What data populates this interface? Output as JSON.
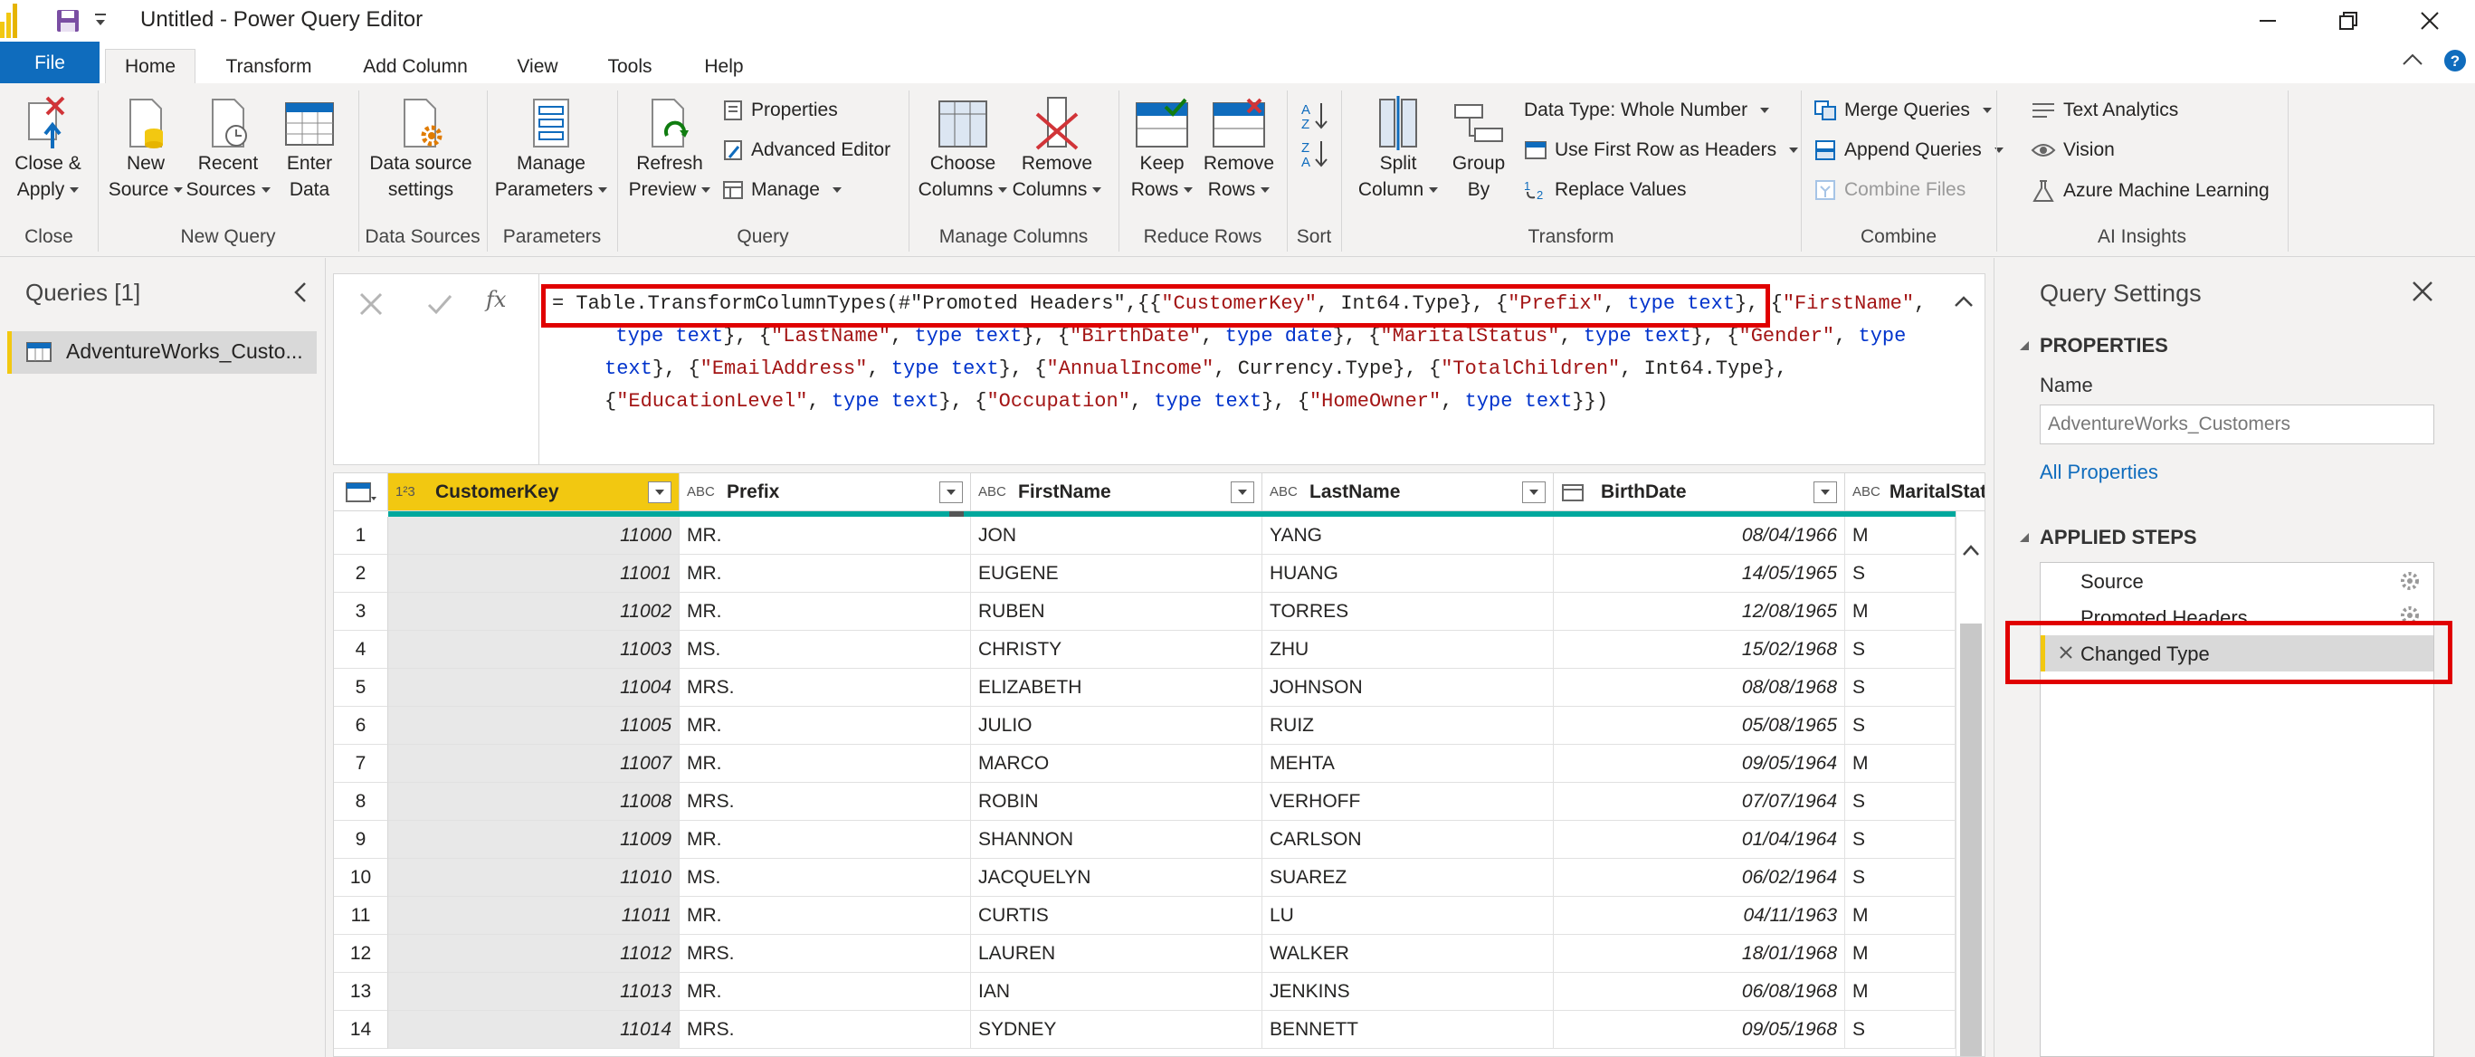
{
  "window": {
    "title": "Untitled - Power Query Editor"
  },
  "tabs": [
    "File",
    "Home",
    "Transform",
    "Add Column",
    "View",
    "Tools",
    "Help"
  ],
  "ribbon": {
    "close_apply": [
      "Close &",
      "Apply"
    ],
    "new_source": [
      "New",
      "Source"
    ],
    "recent_sources": [
      "Recent",
      "Sources"
    ],
    "enter_data": [
      "Enter",
      "Data"
    ],
    "data_source_settings": [
      "Data source",
      "settings"
    ],
    "manage_parameters": [
      "Manage",
      "Parameters"
    ],
    "refresh_preview": [
      "Refresh",
      "Preview"
    ],
    "properties": "Properties",
    "advanced_editor": "Advanced Editor",
    "manage": "Manage",
    "choose_columns": [
      "Choose",
      "Columns"
    ],
    "remove_columns": [
      "Remove",
      "Columns"
    ],
    "keep_rows": [
      "Keep",
      "Rows"
    ],
    "remove_rows": [
      "Remove",
      "Rows"
    ],
    "split_column": [
      "Split",
      "Column"
    ],
    "group_by": [
      "Group",
      "By"
    ],
    "data_type": "Data Type: Whole Number",
    "use_first_row": "Use First Row as Headers",
    "replace_values": "Replace Values",
    "merge_queries": "Merge Queries",
    "append_queries": "Append Queries",
    "combine_files": "Combine Files",
    "text_analytics": "Text Analytics",
    "vision": "Vision",
    "azure_ml": "Azure Machine Learning",
    "groups": [
      "Close",
      "New Query",
      "Data Sources",
      "Parameters",
      "Query",
      "Manage Columns",
      "Reduce Rows",
      "Sort",
      "Transform",
      "Combine",
      "AI Insights"
    ]
  },
  "queries": {
    "header": "Queries [1]",
    "items": [
      "AdventureWorks_Custo..."
    ]
  },
  "formula": {
    "lines": [
      [
        [
          "= Table.TransformColumnTypes(#\"Promoted Headers\",{{",
          "p"
        ],
        [
          "\"CustomerKey\"",
          "s"
        ],
        [
          ", Int64.Type}, {",
          "p"
        ],
        [
          "\"Prefix\"",
          "s"
        ],
        [
          ", ",
          "p"
        ],
        [
          "type text",
          "k"
        ],
        [
          "}, {",
          "p"
        ],
        [
          "\"FirstName\"",
          "s"
        ],
        [
          ",",
          "p"
        ]
      ],
      [
        [
          "  ",
          "p"
        ],
        [
          "type text",
          "k"
        ],
        [
          "}, {",
          "p"
        ],
        [
          "\"LastName\"",
          "s"
        ],
        [
          ", ",
          "p"
        ],
        [
          "type text",
          "k"
        ],
        [
          "}, {",
          "p"
        ],
        [
          "\"BirthDate\"",
          "s"
        ],
        [
          ", ",
          "p"
        ],
        [
          "type date",
          "k"
        ],
        [
          "}, {",
          "p"
        ],
        [
          "\"MaritalStatus\"",
          "s"
        ],
        [
          ", ",
          "p"
        ],
        [
          "type text",
          "k"
        ],
        [
          "}, {",
          "p"
        ],
        [
          "\"Gender\"",
          "s"
        ],
        [
          ", ",
          "p"
        ],
        [
          "type",
          "k"
        ]
      ],
      [
        [
          "text",
          "k"
        ],
        [
          "}, {",
          "p"
        ],
        [
          "\"EmailAddress\"",
          "s"
        ],
        [
          ", ",
          "p"
        ],
        [
          "type text",
          "k"
        ],
        [
          "}, {",
          "p"
        ],
        [
          "\"AnnualIncome\"",
          "s"
        ],
        [
          ", Currency.Type}, {",
          "p"
        ],
        [
          "\"TotalChildren\"",
          "s"
        ],
        [
          ", Int64.Type},",
          "p"
        ]
      ],
      [
        [
          "{",
          "p"
        ],
        [
          "\"EducationLevel\"",
          "s"
        ],
        [
          ", ",
          "p"
        ],
        [
          "type text",
          "k"
        ],
        [
          "}, {",
          "p"
        ],
        [
          "\"Occupation\"",
          "s"
        ],
        [
          ", ",
          "p"
        ],
        [
          "type text",
          "k"
        ],
        [
          "}, {",
          "p"
        ],
        [
          "\"HomeOwner\"",
          "s"
        ],
        [
          ", ",
          "p"
        ],
        [
          "type text",
          "k"
        ],
        [
          "}})",
          "p"
        ]
      ]
    ]
  },
  "table": {
    "columns": [
      {
        "type": "1²3",
        "name": "CustomerKey"
      },
      {
        "type": "ABC",
        "name": "Prefix"
      },
      {
        "type": "ABC",
        "name": "FirstName"
      },
      {
        "type": "ABC",
        "name": "LastName"
      },
      {
        "type": "date",
        "name": "BirthDate"
      },
      {
        "type": "ABC",
        "name": "MaritalStatu"
      }
    ],
    "rows": [
      [
        "1",
        "11000",
        "MR.",
        "JON",
        "YANG",
        "08/04/1966",
        "M"
      ],
      [
        "2",
        "11001",
        "MR.",
        "EUGENE",
        "HUANG",
        "14/05/1965",
        "S"
      ],
      [
        "3",
        "11002",
        "MR.",
        "RUBEN",
        "TORRES",
        "12/08/1965",
        "M"
      ],
      [
        "4",
        "11003",
        "MS.",
        "CHRISTY",
        "ZHU",
        "15/02/1968",
        "S"
      ],
      [
        "5",
        "11004",
        "MRS.",
        "ELIZABETH",
        "JOHNSON",
        "08/08/1968",
        "S"
      ],
      [
        "6",
        "11005",
        "MR.",
        "JULIO",
        "RUIZ",
        "05/08/1965",
        "S"
      ],
      [
        "7",
        "11007",
        "MR.",
        "MARCO",
        "MEHTA",
        "09/05/1964",
        "M"
      ],
      [
        "8",
        "11008",
        "MRS.",
        "ROBIN",
        "VERHOFF",
        "07/07/1964",
        "S"
      ],
      [
        "9",
        "11009",
        "MR.",
        "SHANNON",
        "CARLSON",
        "01/04/1964",
        "S"
      ],
      [
        "10",
        "11010",
        "MS.",
        "JACQUELYN",
        "SUAREZ",
        "06/02/1964",
        "S"
      ],
      [
        "11",
        "11011",
        "MR.",
        "CURTIS",
        "LU",
        "04/11/1963",
        "M"
      ],
      [
        "12",
        "11012",
        "MRS.",
        "LAUREN",
        "WALKER",
        "18/01/1968",
        "M"
      ],
      [
        "13",
        "11013",
        "MR.",
        "IAN",
        "JENKINS",
        "06/08/1968",
        "M"
      ],
      [
        "14",
        "11014",
        "MRS.",
        "SYDNEY",
        "BENNETT",
        "09/05/1968",
        "S"
      ]
    ]
  },
  "settings": {
    "title": "Query Settings",
    "properties_header": "PROPERTIES",
    "name_label": "Name",
    "name_value": "AdventureWorks_Customers",
    "all_properties": "All Properties",
    "applied_steps_header": "APPLIED STEPS",
    "steps": [
      "Source",
      "Promoted Headers",
      "Changed Type"
    ]
  },
  "colors": {
    "accent": "#0f6cbd",
    "selected_column": "#f2c811",
    "highlight": "#e00000",
    "quality_bar": "#00a89d"
  }
}
